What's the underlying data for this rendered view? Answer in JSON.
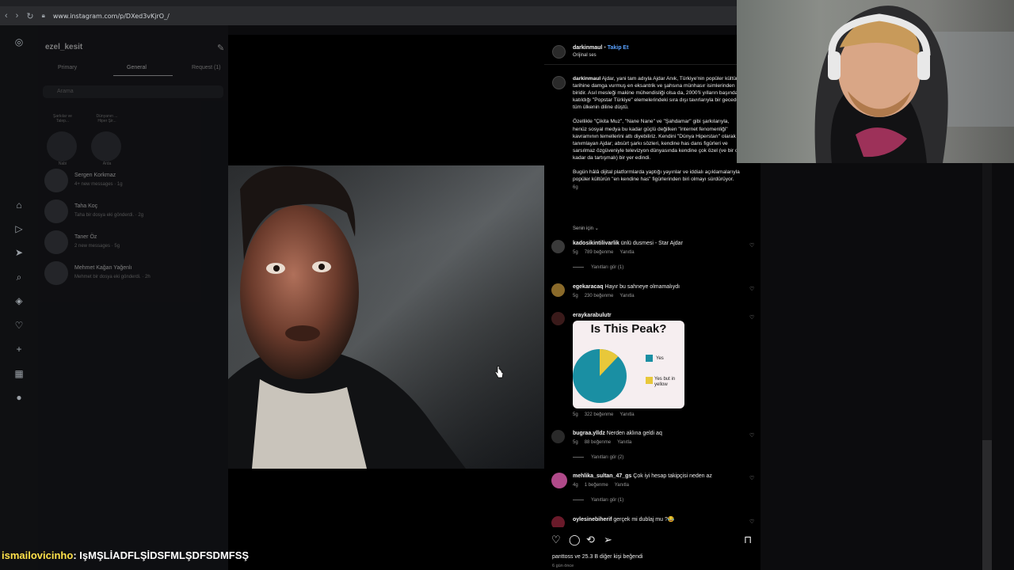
{
  "browser": {
    "url": "www.instagram.com/p/DXed3vKjrO_/"
  },
  "inbox": {
    "username": "ezel_kesit",
    "tabs": [
      "Primary",
      "General",
      "Request (1)"
    ],
    "search_placeholder": "Arama",
    "notes": [
      {
        "bubble": "Şarkılar ve Talep...",
        "name": "Nabi"
      },
      {
        "bubble": "Dünyanın ... Hiper Şir...",
        "name": "Arda"
      }
    ],
    "chats": [
      {
        "name": "Sergen Korkmaz",
        "sub": "4+ new messages · 1g"
      },
      {
        "name": "Taha Koç",
        "sub": "Taha bir dosya eki gönderdi. · 2g"
      },
      {
        "name": "Taner Öz",
        "sub": "2 new messages · 5g"
      },
      {
        "name": "Mehmet Kağan Yağenlı",
        "sub": "Mehmet bir dosya eki gönderdi. · 2h"
      }
    ]
  },
  "post": {
    "author": "darkinmaul",
    "follow": "Takip Et",
    "audio": "Orijinal ses",
    "caption_author": "darkinmaul",
    "caption_p1": "Ajdar, yani tam adıyla Ajdar Anık, Türkiye'nin popüler kültür tarihine damga vurmuş en eksantrik ve şahsına münhasır isimlerinden biridir. Asıl mesleği makine mühendisliği olsa da, 2000'li yılların başında katıldığı \"Popstar Türkiye\" elemelerindeki sıra dışı tavırlarıyla bir gecede tüm ülkenin diline düştü.",
    "caption_p2": "Özellikle \"Çikita Muz\", \"Nane Nane\" ve \"Şahdamar\" gibi şarkılarıyla, henüz sosyal medya bu kadar güçlü değilken \"internet fenomenliği\" kavramının temellerini attı diyebiliriz. Kendini \"Dünya Hiperstarı\" olarak tanımlayan Ajdar; absürt şarkı sözleri, kendine has dans figürleri ve sarsılmaz özgüveniyle televizyon dünyasında kendine çok özel (ve bir o kadar da tartışmalı) bir yer edindi.",
    "caption_p3": "Bugün hâlâ dijital platformlarda yaptığı yayınlar ve iddialı açıklamalarıyla popüler kültürün \"en kendine has\" figürlerinden biri olmayı sürdürüyor.",
    "caption_time": "6g",
    "filter": "Senin için",
    "comments": [
      {
        "user": "kadosikintilivarlik",
        "text": "ünlü dusmesi - Star Ajdar",
        "time": "5g",
        "likes": "789 beğenme",
        "reply": "Yanıtla",
        "replies": "Yanıtları gör (1)"
      },
      {
        "user": "egekaracaq",
        "text": "Hayır bu sahneye olmamalıydı",
        "time": "5g",
        "likes": "230 beğenme",
        "reply": "Yanıtla"
      },
      {
        "user": "eraykarabulutr",
        "text": "",
        "time": "5g",
        "likes": "322 beğenme",
        "reply": "Yanıtla"
      },
      {
        "user": "bugraa.ylldz",
        "text": "Nerden aklına geldi aq",
        "time": "5g",
        "likes": "88 beğenme",
        "reply": "Yanıtla",
        "replies": "Yanıtları gör (2)"
      },
      {
        "user": "mehlika_sultan_47_gs",
        "text": "Çok iyi hesap takipçisi neden az",
        "time": "4g",
        "likes": "1 beğenme",
        "reply": "Yanıtla",
        "replies": "Yanıtları gör (1)"
      },
      {
        "user": "oylesinebiherif",
        "text": "gerçek mi dublaj mu ?😂",
        "time": "",
        "likes": "",
        "reply": ""
      }
    ],
    "peak_image": {
      "title": "Is This Peak?",
      "legend_yes": "Yes",
      "legend_yellow": "Yes but in yellow",
      "yes_share": 0.88,
      "yellow_share": 0.12,
      "color_yes": "#1a8fa3",
      "color_yellow": "#e8c83a"
    },
    "likes_line": "panttoss ve 25.3 B diğer kişi beğendi",
    "ago": "6 gün önce"
  },
  "stream_chat": {
    "user": "ismailovicinho",
    "sep": ":",
    "message": "IşMŞLİADFLŞİDSFMLŞDFSDMFSŞ"
  }
}
